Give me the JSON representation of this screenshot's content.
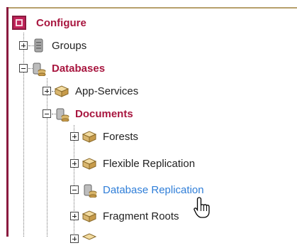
{
  "tree": {
    "root": {
      "label": "Configure",
      "icon": "configure-icon"
    },
    "groups": {
      "label": "Groups",
      "icon": "server-icon",
      "toggle": "expand"
    },
    "databases": {
      "label": "Databases",
      "icon": "database-icon",
      "toggle": "collapse"
    },
    "app_services": {
      "label": "App-Services",
      "icon": "folder-box-icon",
      "toggle": "expand"
    },
    "documents": {
      "label": "Documents",
      "icon": "database-icon",
      "toggle": "collapse"
    },
    "forests": {
      "label": "Forests",
      "icon": "folder-box-icon",
      "toggle": "expand"
    },
    "flexible_replication": {
      "label": "Flexible Replication",
      "icon": "folder-box-icon",
      "toggle": "expand"
    },
    "database_replication": {
      "label": "Database Replication",
      "icon": "database-icon",
      "toggle": "collapse",
      "hovered": true
    },
    "fragment_roots": {
      "label": "Fragment Roots",
      "icon": "folder-box-icon",
      "toggle": "expand"
    }
  },
  "colors": {
    "accent": "#a8163f",
    "link": "#2f7ed8",
    "frame": "#8a1a3f"
  },
  "cursor": {
    "type": "hand-pointer-icon"
  }
}
